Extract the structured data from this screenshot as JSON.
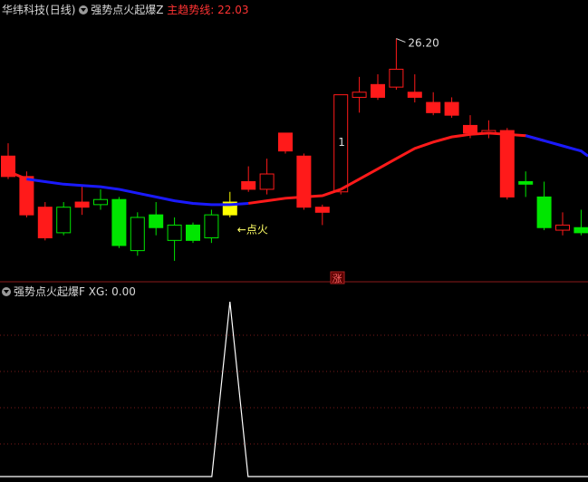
{
  "header": {
    "stock_name": "华纬科技",
    "period": "(日线)",
    "indicator": "强势点火起爆Z",
    "trend_label": "主趋势线:",
    "trend_value": "22.03"
  },
  "sub_header": {
    "indicator": "强势点火起爆F",
    "xg_label": "XG:",
    "xg_value": "0.00"
  },
  "annotations": {
    "high_price": "26.20",
    "ignite": "←点火",
    "signal_num": "1",
    "zhang": "涨"
  },
  "colors": {
    "up": "#ff1a1a",
    "down": "#00e600",
    "signal": "#ffff00",
    "trend_down": "#1a1aff",
    "trend_up": "#ff1a1a",
    "grid": "#7a1a1a"
  },
  "chart_data": {
    "type": "candlestick",
    "ylim": [
      17,
      27
    ],
    "candles": [
      {
        "o": 21.6,
        "c": 20.8,
        "h": 22.1,
        "l": 20.7,
        "dir": "down"
      },
      {
        "o": 20.8,
        "c": 19.3,
        "h": 21.0,
        "l": 19.2,
        "dir": "down"
      },
      {
        "o": 19.6,
        "c": 18.4,
        "h": 19.8,
        "l": 18.3,
        "dir": "down"
      },
      {
        "o": 18.6,
        "c": 19.6,
        "h": 19.8,
        "l": 18.5,
        "dir": "up-hollow"
      },
      {
        "o": 19.6,
        "c": 19.8,
        "h": 20.4,
        "l": 19.3,
        "dir": "down"
      },
      {
        "o": 19.7,
        "c": 19.9,
        "h": 20.3,
        "l": 19.5,
        "dir": "up-hollow"
      },
      {
        "o": 19.9,
        "c": 18.1,
        "h": 20.0,
        "l": 18.0,
        "dir": "down-green"
      },
      {
        "o": 17.9,
        "c": 19.2,
        "h": 19.4,
        "l": 17.7,
        "dir": "up-hollow"
      },
      {
        "o": 19.3,
        "c": 18.8,
        "h": 19.8,
        "l": 18.5,
        "dir": "down-green"
      },
      {
        "o": 18.3,
        "c": 18.9,
        "h": 19.2,
        "l": 17.5,
        "dir": "up-hollow"
      },
      {
        "o": 18.9,
        "c": 18.3,
        "h": 19.0,
        "l": 18.2,
        "dir": "down-green"
      },
      {
        "o": 18.4,
        "c": 19.3,
        "h": 19.5,
        "l": 18.2,
        "dir": "up-hollow"
      },
      {
        "o": 19.3,
        "c": 19.8,
        "h": 20.2,
        "l": 19.2,
        "dir": "signal"
      },
      {
        "o": 20.6,
        "c": 20.3,
        "h": 21.2,
        "l": 20.2,
        "dir": "down"
      },
      {
        "o": 20.3,
        "c": 20.9,
        "h": 21.5,
        "l": 20.1,
        "dir": "up-hollow"
      },
      {
        "o": 22.5,
        "c": 21.8,
        "h": 22.5,
        "l": 21.7,
        "dir": "down"
      },
      {
        "o": 21.6,
        "c": 19.6,
        "h": 21.7,
        "l": 19.5,
        "dir": "down"
      },
      {
        "o": 19.6,
        "c": 19.4,
        "h": 19.7,
        "l": 18.9,
        "dir": "down"
      },
      {
        "o": 20.2,
        "c": 24.0,
        "h": 24.0,
        "l": 20.1,
        "dir": "up-hollow"
      },
      {
        "o": 23.9,
        "c": 24.1,
        "h": 24.7,
        "l": 23.3,
        "dir": "up-hollow"
      },
      {
        "o": 23.9,
        "c": 24.4,
        "h": 24.8,
        "l": 23.8,
        "dir": "down"
      },
      {
        "o": 24.3,
        "c": 25.0,
        "h": 26.2,
        "l": 24.2,
        "dir": "up-hollow"
      },
      {
        "o": 24.1,
        "c": 23.9,
        "h": 24.8,
        "l": 23.7,
        "dir": "down"
      },
      {
        "o": 23.7,
        "c": 23.3,
        "h": 24.1,
        "l": 23.2,
        "dir": "down"
      },
      {
        "o": 23.7,
        "c": 23.2,
        "h": 23.9,
        "l": 23.1,
        "dir": "down"
      },
      {
        "o": 22.8,
        "c": 22.5,
        "h": 23.2,
        "l": 22.3,
        "dir": "down"
      },
      {
        "o": 22.6,
        "c": 22.5,
        "h": 23.0,
        "l": 22.3,
        "dir": "up-hollow"
      },
      {
        "o": 22.6,
        "c": 20.0,
        "h": 22.7,
        "l": 19.9,
        "dir": "down"
      },
      {
        "o": 20.5,
        "c": 20.6,
        "h": 21.0,
        "l": 20.0,
        "dir": "up-flat"
      },
      {
        "o": 20.0,
        "c": 18.8,
        "h": 20.6,
        "l": 18.7,
        "dir": "down-green"
      },
      {
        "o": 18.7,
        "c": 18.9,
        "h": 19.4,
        "l": 18.5,
        "dir": "up-hollow"
      },
      {
        "o": 18.8,
        "c": 18.6,
        "h": 19.5,
        "l": 18.5,
        "dir": "down-green"
      }
    ],
    "trend": [
      21.0,
      20.7,
      20.6,
      20.5,
      20.45,
      20.4,
      20.3,
      20.15,
      20.0,
      19.85,
      19.75,
      19.7,
      19.7,
      19.75,
      19.85,
      19.95,
      20.0,
      20.05,
      20.3,
      20.7,
      21.1,
      21.5,
      21.9,
      22.15,
      22.35,
      22.45,
      22.5,
      22.45,
      22.4,
      22.2,
      22.0,
      21.8
    ],
    "trend_turn_index": 12,
    "sub_signal_index": 12,
    "sub_ylim": [
      0,
      1
    ]
  }
}
